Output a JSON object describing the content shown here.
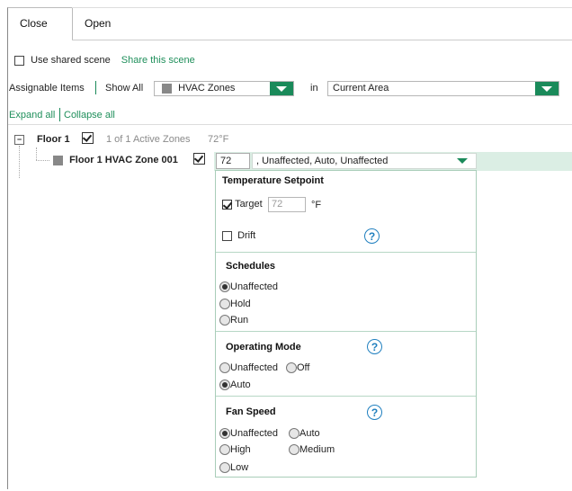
{
  "tabs": {
    "close": "Close",
    "open": "Open"
  },
  "shared_scene": {
    "label": "Use shared scene",
    "share_link": "Share this scene"
  },
  "assignable": {
    "label": "Assignable Items",
    "show_all": "Show All",
    "zone_select": "HVAC Zones",
    "in_label": "in",
    "area_select": "Current Area"
  },
  "expand_all": "Expand all",
  "collapse_all": "Collapse all",
  "tree": {
    "floor": {
      "expander": "−",
      "label": "Floor 1",
      "active_zones": "1 of 1 Active Zones",
      "temp": "72°F"
    },
    "zone": {
      "label": "Floor 1 HVAC Zone 001",
      "input_value": "72",
      "combo_text": ", Unaffected, Auto, Unaffected"
    }
  },
  "panel": {
    "temperature": {
      "title": "Temperature Setpoint",
      "target_label": "Target",
      "target_value": "72",
      "unit": "°F",
      "drift_label": "Drift",
      "help": "?"
    },
    "schedules": {
      "title": "Schedules",
      "options": [
        "Unaffected",
        "Hold",
        "Run"
      ],
      "selected": "Unaffected"
    },
    "operating_mode": {
      "title": "Operating Mode",
      "help": "?",
      "options": [
        "Unaffected",
        "Off",
        "Auto"
      ],
      "selected": "Auto"
    },
    "fan_speed": {
      "title": "Fan Speed",
      "help": "?",
      "options": [
        "Unaffected",
        "Auto",
        "High",
        "Medium",
        "Low"
      ],
      "selected": "Unaffected"
    }
  },
  "colors": {
    "accent": "#1a8a5a",
    "link": "#1f8f5b",
    "help": "#1f7fbf",
    "row_highlight": "#dbeee4"
  }
}
